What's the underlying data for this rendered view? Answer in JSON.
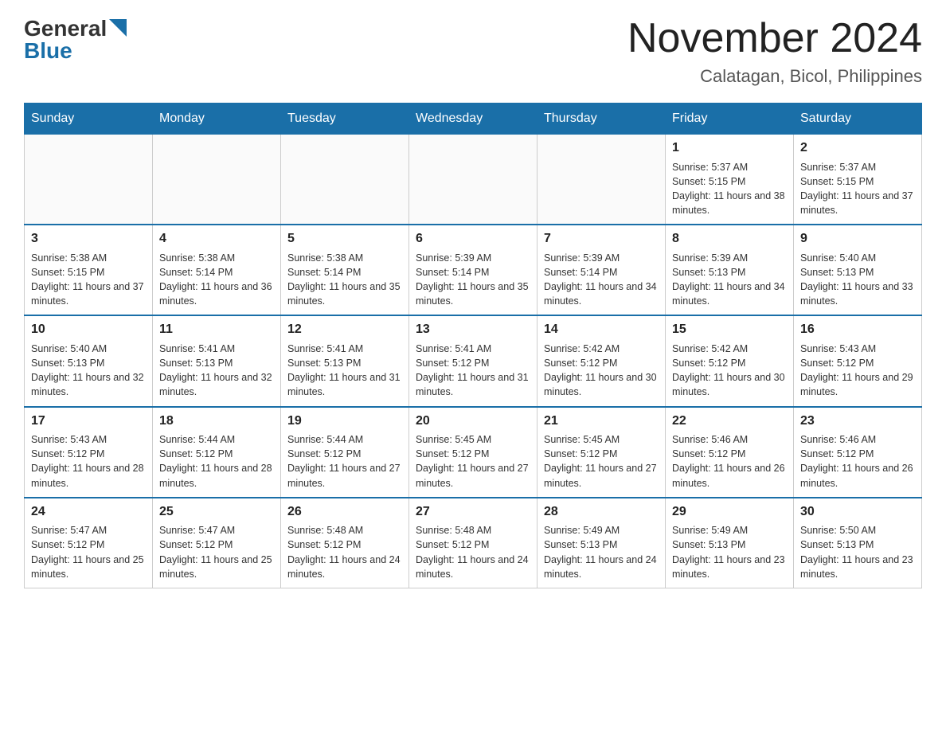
{
  "header": {
    "logo_general": "General",
    "logo_blue": "Blue",
    "title": "November 2024",
    "subtitle": "Calatagan, Bicol, Philippines"
  },
  "days_of_week": [
    "Sunday",
    "Monday",
    "Tuesday",
    "Wednesday",
    "Thursday",
    "Friday",
    "Saturday"
  ],
  "weeks": [
    [
      {
        "day": "",
        "info": ""
      },
      {
        "day": "",
        "info": ""
      },
      {
        "day": "",
        "info": ""
      },
      {
        "day": "",
        "info": ""
      },
      {
        "day": "",
        "info": ""
      },
      {
        "day": "1",
        "info": "Sunrise: 5:37 AM\nSunset: 5:15 PM\nDaylight: 11 hours and 38 minutes."
      },
      {
        "day": "2",
        "info": "Sunrise: 5:37 AM\nSunset: 5:15 PM\nDaylight: 11 hours and 37 minutes."
      }
    ],
    [
      {
        "day": "3",
        "info": "Sunrise: 5:38 AM\nSunset: 5:15 PM\nDaylight: 11 hours and 37 minutes."
      },
      {
        "day": "4",
        "info": "Sunrise: 5:38 AM\nSunset: 5:14 PM\nDaylight: 11 hours and 36 minutes."
      },
      {
        "day": "5",
        "info": "Sunrise: 5:38 AM\nSunset: 5:14 PM\nDaylight: 11 hours and 35 minutes."
      },
      {
        "day": "6",
        "info": "Sunrise: 5:39 AM\nSunset: 5:14 PM\nDaylight: 11 hours and 35 minutes."
      },
      {
        "day": "7",
        "info": "Sunrise: 5:39 AM\nSunset: 5:14 PM\nDaylight: 11 hours and 34 minutes."
      },
      {
        "day": "8",
        "info": "Sunrise: 5:39 AM\nSunset: 5:13 PM\nDaylight: 11 hours and 34 minutes."
      },
      {
        "day": "9",
        "info": "Sunrise: 5:40 AM\nSunset: 5:13 PM\nDaylight: 11 hours and 33 minutes."
      }
    ],
    [
      {
        "day": "10",
        "info": "Sunrise: 5:40 AM\nSunset: 5:13 PM\nDaylight: 11 hours and 32 minutes."
      },
      {
        "day": "11",
        "info": "Sunrise: 5:41 AM\nSunset: 5:13 PM\nDaylight: 11 hours and 32 minutes."
      },
      {
        "day": "12",
        "info": "Sunrise: 5:41 AM\nSunset: 5:13 PM\nDaylight: 11 hours and 31 minutes."
      },
      {
        "day": "13",
        "info": "Sunrise: 5:41 AM\nSunset: 5:12 PM\nDaylight: 11 hours and 31 minutes."
      },
      {
        "day": "14",
        "info": "Sunrise: 5:42 AM\nSunset: 5:12 PM\nDaylight: 11 hours and 30 minutes."
      },
      {
        "day": "15",
        "info": "Sunrise: 5:42 AM\nSunset: 5:12 PM\nDaylight: 11 hours and 30 minutes."
      },
      {
        "day": "16",
        "info": "Sunrise: 5:43 AM\nSunset: 5:12 PM\nDaylight: 11 hours and 29 minutes."
      }
    ],
    [
      {
        "day": "17",
        "info": "Sunrise: 5:43 AM\nSunset: 5:12 PM\nDaylight: 11 hours and 28 minutes."
      },
      {
        "day": "18",
        "info": "Sunrise: 5:44 AM\nSunset: 5:12 PM\nDaylight: 11 hours and 28 minutes."
      },
      {
        "day": "19",
        "info": "Sunrise: 5:44 AM\nSunset: 5:12 PM\nDaylight: 11 hours and 27 minutes."
      },
      {
        "day": "20",
        "info": "Sunrise: 5:45 AM\nSunset: 5:12 PM\nDaylight: 11 hours and 27 minutes."
      },
      {
        "day": "21",
        "info": "Sunrise: 5:45 AM\nSunset: 5:12 PM\nDaylight: 11 hours and 27 minutes."
      },
      {
        "day": "22",
        "info": "Sunrise: 5:46 AM\nSunset: 5:12 PM\nDaylight: 11 hours and 26 minutes."
      },
      {
        "day": "23",
        "info": "Sunrise: 5:46 AM\nSunset: 5:12 PM\nDaylight: 11 hours and 26 minutes."
      }
    ],
    [
      {
        "day": "24",
        "info": "Sunrise: 5:47 AM\nSunset: 5:12 PM\nDaylight: 11 hours and 25 minutes."
      },
      {
        "day": "25",
        "info": "Sunrise: 5:47 AM\nSunset: 5:12 PM\nDaylight: 11 hours and 25 minutes."
      },
      {
        "day": "26",
        "info": "Sunrise: 5:48 AM\nSunset: 5:12 PM\nDaylight: 11 hours and 24 minutes."
      },
      {
        "day": "27",
        "info": "Sunrise: 5:48 AM\nSunset: 5:12 PM\nDaylight: 11 hours and 24 minutes."
      },
      {
        "day": "28",
        "info": "Sunrise: 5:49 AM\nSunset: 5:13 PM\nDaylight: 11 hours and 24 minutes."
      },
      {
        "day": "29",
        "info": "Sunrise: 5:49 AM\nSunset: 5:13 PM\nDaylight: 11 hours and 23 minutes."
      },
      {
        "day": "30",
        "info": "Sunrise: 5:50 AM\nSunset: 5:13 PM\nDaylight: 11 hours and 23 minutes."
      }
    ]
  ]
}
